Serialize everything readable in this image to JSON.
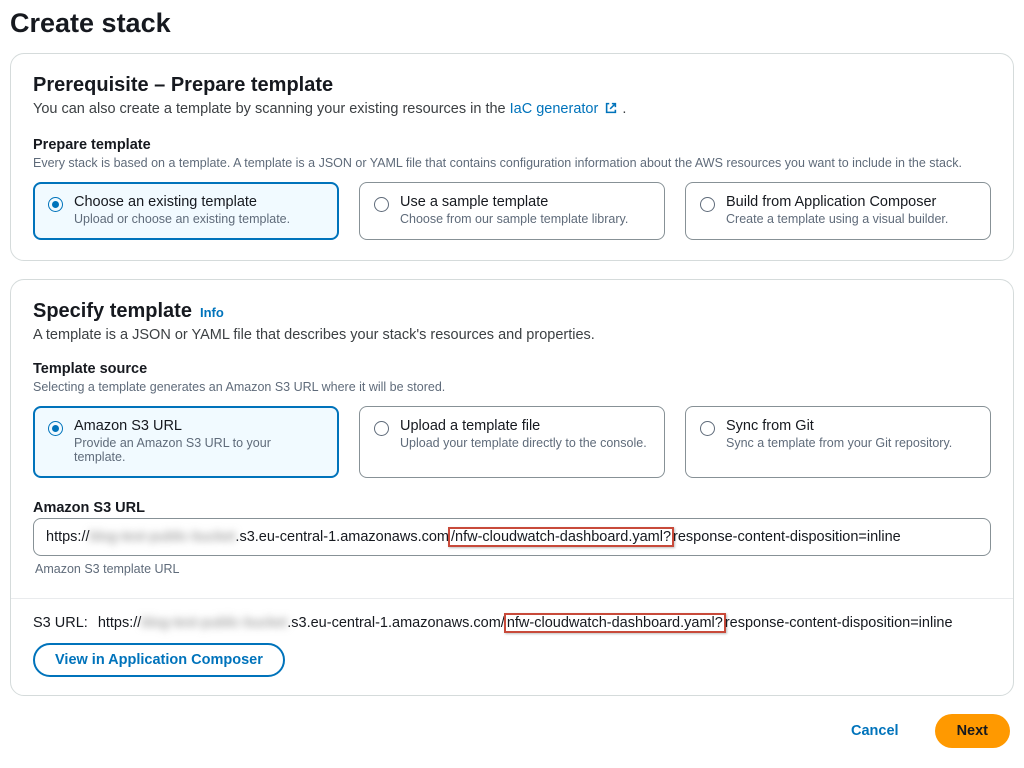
{
  "page_title": "Create stack",
  "prereq": {
    "title": "Prerequisite – Prepare template",
    "desc_prefix": "You can also create a template by scanning your existing resources in the ",
    "iac_link": "IaC generator",
    "desc_suffix": ".",
    "prepare_label": "Prepare template",
    "prepare_help": "Every stack is based on a template. A template is a JSON or YAML file that contains configuration information about the AWS resources you want to include in the stack.",
    "options": [
      {
        "title": "Choose an existing template",
        "sub": "Upload or choose an existing template.",
        "selected": true
      },
      {
        "title": "Use a sample template",
        "sub": "Choose from our sample template library.",
        "selected": false
      },
      {
        "title": "Build from Application Composer",
        "sub": "Create a template using a visual builder.",
        "selected": false
      }
    ]
  },
  "specify": {
    "title": "Specify template",
    "info": "Info",
    "desc": "A template is a JSON or YAML file that describes your stack's resources and properties.",
    "source_label": "Template source",
    "source_help": "Selecting a template generates an Amazon S3 URL where it will be stored.",
    "options": [
      {
        "title": "Amazon S3 URL",
        "sub": "Provide an Amazon S3 URL to your template.",
        "selected": true
      },
      {
        "title": "Upload a template file",
        "sub": "Upload your template directly to the console.",
        "selected": false
      },
      {
        "title": "Sync from Git",
        "sub": "Sync a template from your Git repository.",
        "selected": false
      }
    ],
    "s3_label": "Amazon S3 URL",
    "s3_url_parts": {
      "p1": "https://",
      "blur1": "blog-test-public-bucket",
      "p2": ".s3.eu-central-1.amazonaws.com",
      "hl": "/nfw-cloudwatch-dashboard.yaml?",
      "p3": "response-content-disposition=inline"
    },
    "s3_below_help": "Amazon S3 template URL",
    "footer": {
      "s3_label": "S3 URL:",
      "p1": "https://",
      "blur1": "blog-test-public-bucket",
      "p2": ".s3.eu-central-1.amazonaws.com/",
      "hl": "nfw-cloudwatch-dashboard.yaml?",
      "p3": "response-content-disposition=inline",
      "view_btn": "View in Application Composer"
    }
  },
  "actions": {
    "cancel": "Cancel",
    "next": "Next"
  }
}
